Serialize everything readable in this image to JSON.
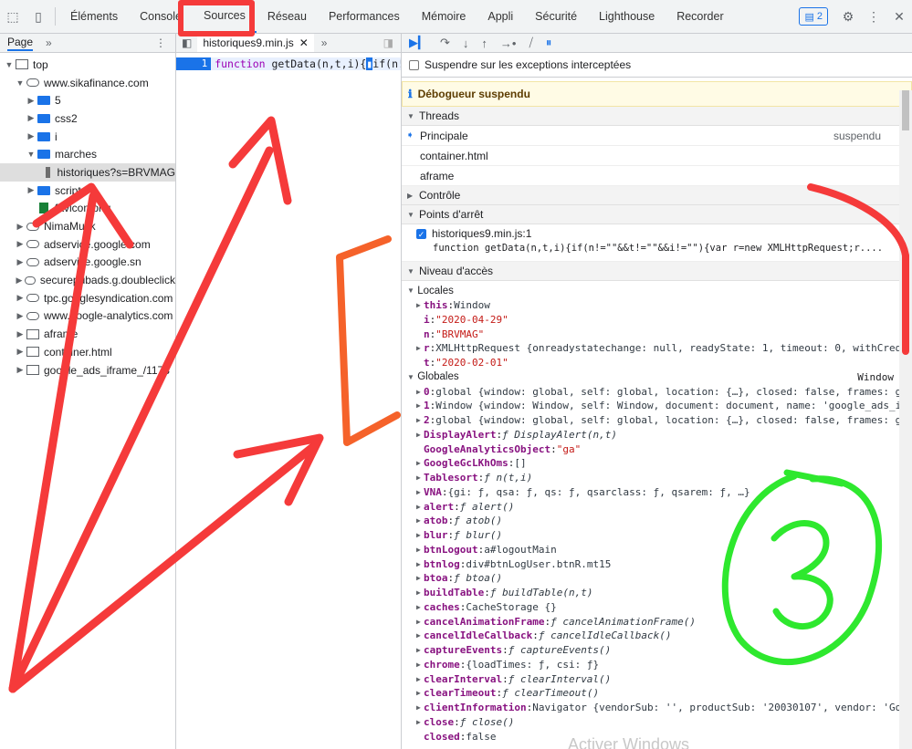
{
  "toolbar": {
    "tabs": [
      "Éléments",
      "Console",
      "Sources",
      "Réseau",
      "Performances",
      "Mémoire",
      "Appli",
      "Sécurité",
      "Lighthouse",
      "Recorder"
    ],
    "active_tab": "Sources",
    "issues_count": "2"
  },
  "navigator": {
    "tab_label": "Page",
    "more": "»",
    "tree": [
      {
        "label": "top",
        "depth": 0,
        "arrow": "▼",
        "icon": "frame"
      },
      {
        "label": "www.sikafinance.com",
        "depth": 1,
        "arrow": "▼",
        "icon": "cloud"
      },
      {
        "label": "5",
        "depth": 2,
        "arrow": "▶",
        "icon": "folder"
      },
      {
        "label": "css2",
        "depth": 2,
        "arrow": "▶",
        "icon": "folder"
      },
      {
        "label": "i",
        "depth": 2,
        "arrow": "▶",
        "icon": "folder"
      },
      {
        "label": "marches",
        "depth": 2,
        "arrow": "▼",
        "icon": "folder"
      },
      {
        "label": "historiques?s=BRVMAG",
        "depth": 3,
        "arrow": "",
        "icon": "doc",
        "selected": true
      },
      {
        "label": "scripts",
        "depth": 2,
        "arrow": "▶",
        "icon": "folder"
      },
      {
        "label": "favicon.png",
        "depth": 2,
        "arrow": "",
        "icon": "docg"
      },
      {
        "label": "NimaMusk",
        "depth": 1,
        "arrow": "▶",
        "icon": "cloud"
      },
      {
        "label": "adservice.google.com",
        "depth": 1,
        "arrow": "▶",
        "icon": "cloud"
      },
      {
        "label": "adservice.google.sn",
        "depth": 1,
        "arrow": "▶",
        "icon": "cloud"
      },
      {
        "label": "securepubads.g.doubleclick",
        "depth": 1,
        "arrow": "▶",
        "icon": "cloud"
      },
      {
        "label": "tpc.googlesyndication.com",
        "depth": 1,
        "arrow": "▶",
        "icon": "cloud"
      },
      {
        "label": "www.google-analytics.com",
        "depth": 1,
        "arrow": "▶",
        "icon": "cloud"
      },
      {
        "label": "aframe",
        "depth": 1,
        "arrow": "▶",
        "icon": "frame"
      },
      {
        "label": "container.html",
        "depth": 1,
        "arrow": "▶",
        "icon": "frame"
      },
      {
        "label": "google_ads_iframe_/1178",
        "depth": 1,
        "arrow": "▶",
        "icon": "frame"
      }
    ]
  },
  "editor": {
    "file_tab": "historiques9.min.js",
    "line_no": "1",
    "code_kw": "function",
    "code_rest": " getData(n,t,i){",
    "code_tail": "if(n!="
  },
  "debugger": {
    "pause_exceptions": "Suspendre sur les exceptions interceptées",
    "paused_msg": "Débogueur suspendu",
    "threads_title": "Threads",
    "threads": [
      {
        "name": "Principale",
        "status": "suspendu",
        "current": true
      },
      {
        "name": "container.html",
        "status": ""
      },
      {
        "name": "aframe",
        "status": ""
      }
    ],
    "watch_title": "Contrôle",
    "breakpoints_title": "Points d'arrêt",
    "breakpoint_file": "historiques9.min.js:1",
    "breakpoint_code": "function getData(n,t,i){if(n!=\"\"&&t!=\"\"&&i!=\"\"){var r=new XMLHttpRequest;r....",
    "scope_title": "Niveau d'accès",
    "locals_title": "Locales",
    "globals_title": "Globales",
    "globals_right": "Window"
  },
  "scope_lines": [
    {
      "indent": 1,
      "arrow": "▶",
      "k": "this",
      "v": "Window",
      "t": "obj"
    },
    {
      "indent": 1,
      "arrow": "",
      "k": "i",
      "v": "\"2020-04-29\"",
      "t": "str"
    },
    {
      "indent": 1,
      "arrow": "",
      "k": "n",
      "v": "\"BRVMAG\"",
      "t": "str"
    },
    {
      "indent": 1,
      "arrow": "▶",
      "k": "r",
      "v": "XMLHttpRequest {onreadystatechange: null, readyState: 1, timeout: 0, withCred",
      "t": "obj"
    },
    {
      "indent": 1,
      "arrow": "",
      "k": "t",
      "v": "\"2020-02-01\"",
      "t": "str"
    }
  ],
  "global_lines": [
    {
      "arrow": "▶",
      "k": "0",
      "v": "global {window: global, self: global, location: {…}, closed: false, frames: g",
      "t": "obj"
    },
    {
      "arrow": "▶",
      "k": "1",
      "v": "Window {window: Window, self: Window, document: document, name: 'google_ads_i",
      "t": "obj"
    },
    {
      "arrow": "▶",
      "k": "2",
      "v": "global {window: global, self: global, location: {…}, closed: false, frames: g",
      "t": "obj"
    },
    {
      "arrow": "▶",
      "k": "DisplayAlert",
      "v": "ƒ DisplayAlert(n,t)",
      "t": "fn"
    },
    {
      "arrow": "",
      "k": "GoogleAnalyticsObject",
      "v": "\"ga\"",
      "t": "str"
    },
    {
      "arrow": "▶",
      "k": "GoogleGcLKhOms",
      "v": "[]",
      "t": "obj"
    },
    {
      "arrow": "▶",
      "k": "Tablesort",
      "v": "ƒ n(t,i)",
      "t": "fn"
    },
    {
      "arrow": "▶",
      "k": "VNA",
      "v": "{gi: ƒ, qsa: ƒ, qs: ƒ, qsarclass: ƒ, qsarem: ƒ, …}",
      "t": "obj"
    },
    {
      "arrow": "▶",
      "k": "alert",
      "v": "ƒ alert()",
      "t": "fn"
    },
    {
      "arrow": "▶",
      "k": "atob",
      "v": "ƒ atob()",
      "t": "fn"
    },
    {
      "arrow": "▶",
      "k": "blur",
      "v": "ƒ blur()",
      "t": "fn"
    },
    {
      "arrow": "▶",
      "k": "btnLogout",
      "v": "a#logoutMain",
      "t": "obj"
    },
    {
      "arrow": "▶",
      "k": "btnlog",
      "v": "div#btnLogUser.btnR.mt15",
      "t": "obj"
    },
    {
      "arrow": "▶",
      "k": "btoa",
      "v": "ƒ btoa()",
      "t": "fn"
    },
    {
      "arrow": "▶",
      "k": "buildTable",
      "v": "ƒ buildTable(n,t)",
      "t": "fn"
    },
    {
      "arrow": "▶",
      "k": "caches",
      "v": "CacheStorage {}",
      "t": "obj"
    },
    {
      "arrow": "▶",
      "k": "cancelAnimationFrame",
      "v": "ƒ cancelAnimationFrame()",
      "t": "fn"
    },
    {
      "arrow": "▶",
      "k": "cancelIdleCallback",
      "v": "ƒ cancelIdleCallback()",
      "t": "fn"
    },
    {
      "arrow": "▶",
      "k": "captureEvents",
      "v": "ƒ captureEvents()",
      "t": "fn"
    },
    {
      "arrow": "▶",
      "k": "chrome",
      "v": "{loadTimes: ƒ, csi: ƒ}",
      "t": "obj"
    },
    {
      "arrow": "▶",
      "k": "clearInterval",
      "v": "ƒ clearInterval()",
      "t": "fn"
    },
    {
      "arrow": "▶",
      "k": "clearTimeout",
      "v": "ƒ clearTimeout()",
      "t": "fn"
    },
    {
      "arrow": "▶",
      "k": "clientInformation",
      "v": "Navigator {vendorSub: '', productSub: '20030107', vendor: 'Go",
      "t": "obj"
    },
    {
      "arrow": "▶",
      "k": "close",
      "v": "ƒ close()",
      "t": "fn"
    },
    {
      "arrow": "",
      "k": "closed",
      "v": "false",
      "t": "obj"
    }
  ],
  "annotation": {
    "number": "3",
    "red": "#f53a3a",
    "orange": "#f5622a",
    "green": "#2ee82e"
  }
}
